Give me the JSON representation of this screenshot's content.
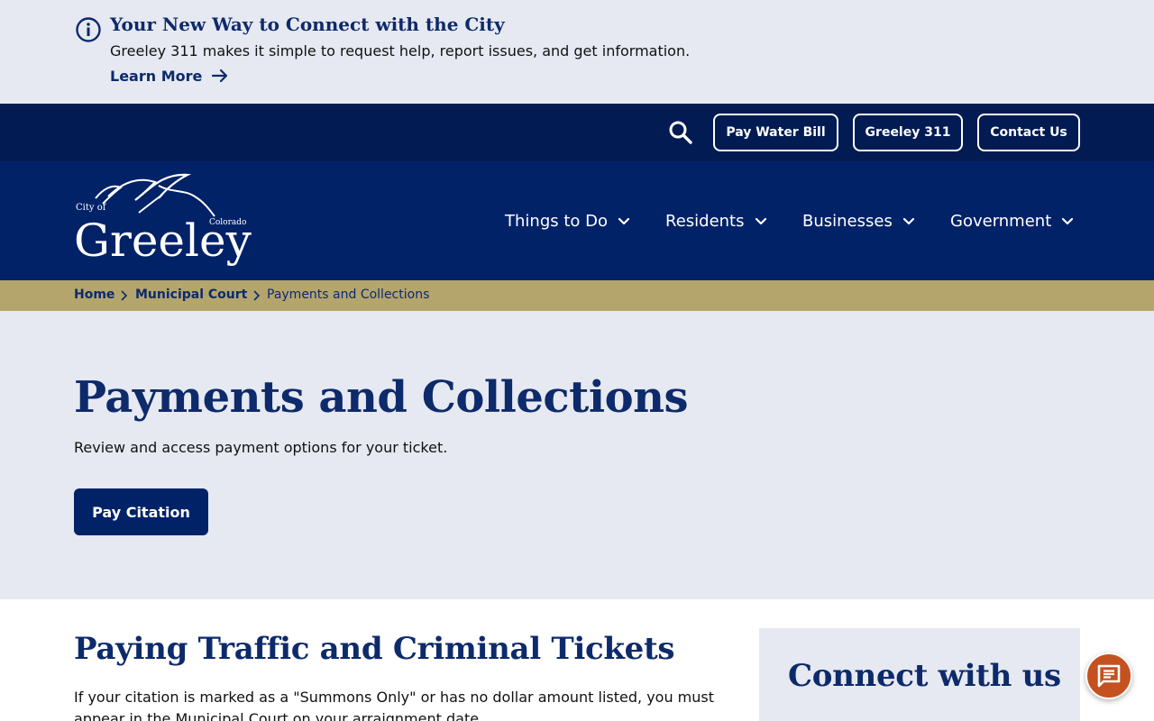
{
  "alert": {
    "icon": "info-icon",
    "title": "Your New Way to Connect with the City",
    "text": "Greeley 311 makes it simple to request help, report issues, and get information.",
    "learn_more": "Learn More"
  },
  "utility_bar": {
    "search_icon": "search-icon",
    "buttons": [
      {
        "label": "Pay Water Bill"
      },
      {
        "label": "Greeley 311"
      },
      {
        "label": "Contact Us"
      }
    ]
  },
  "logo": {
    "small_text_left": "City of",
    "small_text_right": "Colorado",
    "wordmark": "Greeley"
  },
  "nav": {
    "items": [
      {
        "label": "Things to Do"
      },
      {
        "label": "Residents"
      },
      {
        "label": "Businesses"
      },
      {
        "label": "Government"
      }
    ]
  },
  "breadcrumb": {
    "items": [
      {
        "label": "Home"
      },
      {
        "label": "Municipal Court"
      },
      {
        "label": "Payments and Collections"
      }
    ]
  },
  "hero": {
    "title": "Payments and Collections",
    "subtitle": "Review and access payment options for your ticket.",
    "button": "Pay Citation"
  },
  "main": {
    "section_title": "Paying Traffic and Criminal Tickets",
    "section_body": "If your citation is marked as a \"Summons Only\" or has no dollar amount listed, you must appear in the Municipal Court on your arraignment date."
  },
  "sidebar": {
    "title": "Connect with us"
  },
  "chat": {
    "icon": "chat-icon"
  },
  "colors": {
    "navy": "#022268",
    "navy_dark": "#021b52",
    "gold": "#b4a56d",
    "light_bg": "#e6e9f1",
    "heading": "#0d2a6b",
    "chat": "#c4511f"
  }
}
